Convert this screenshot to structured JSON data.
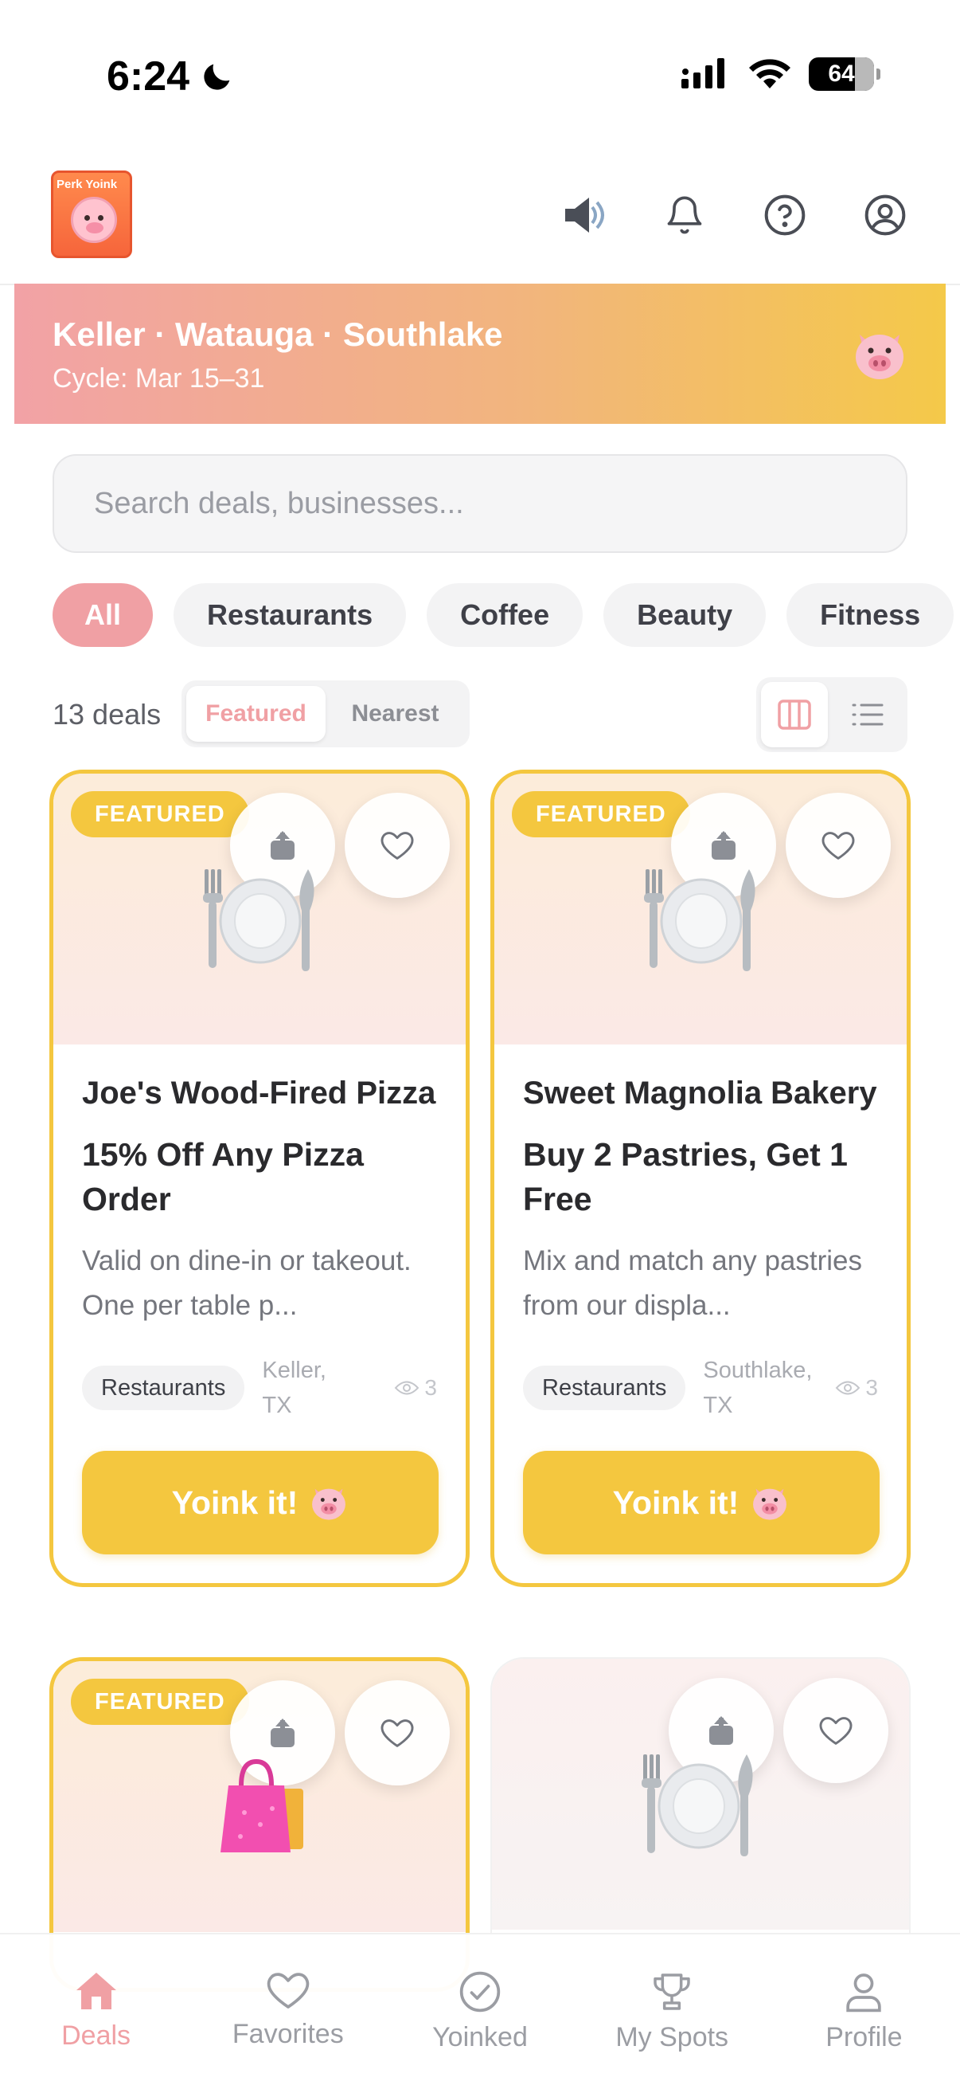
{
  "status_bar": {
    "time": "6:24",
    "battery": "64"
  },
  "header": {
    "logo_text": "Perk Yoink",
    "icons": [
      "speaker-icon",
      "bell-icon",
      "help-icon",
      "account-icon"
    ]
  },
  "banner": {
    "title": "Keller · Watauga · Southlake",
    "cycle": "Cycle: Mar 15–31"
  },
  "search": {
    "placeholder": "Search deals, businesses..."
  },
  "categories": [
    "All",
    "Restaurants",
    "Coffee",
    "Beauty",
    "Fitness"
  ],
  "active_category": "All",
  "toolbar": {
    "deal_count": "13 deals",
    "sort_options": [
      "Featured",
      "Nearest"
    ],
    "active_sort": "Featured",
    "view_modes": [
      "grid-icon",
      "list-icon"
    ],
    "active_view": "grid"
  },
  "deals": [
    {
      "badge": "FEATURED",
      "business": "Joe's Wood-Fired Pizza",
      "title": "15% Off Any Pizza Order",
      "description": "Valid on dine-in or takeout. One per table p...",
      "category": "Restaurants",
      "location": "Keller, TX",
      "views": "3",
      "cta": "Yoink it!",
      "image_icon": "plate-cutlery-icon"
    },
    {
      "badge": "FEATURED",
      "business": "Sweet Magnolia Bakery",
      "title": "Buy 2 Pastries, Get 1 Free",
      "description": "Mix and match any pastries from our displa...",
      "category": "Restaurants",
      "location": "Southlake, TX",
      "views": "3",
      "cta": "Yoink it!",
      "image_icon": "plate-cutlery-icon"
    },
    {
      "badge": "FEATURED",
      "image_icon": "shopping-bags-icon"
    },
    {
      "image_icon": "plate-cutlery-icon"
    }
  ],
  "nav": {
    "items": [
      {
        "label": "Deals",
        "icon": "home-icon"
      },
      {
        "label": "Favorites",
        "icon": "heart-icon"
      },
      {
        "label": "Yoinked",
        "icon": "check-circle-icon"
      },
      {
        "label": "My Spots",
        "icon": "trophy-icon"
      },
      {
        "label": "Profile",
        "icon": "person-icon"
      }
    ],
    "active": "Deals"
  },
  "colors": {
    "accent_pink": "#f0a0a4",
    "accent_yellow": "#f4c73f",
    "banner_gradient": [
      "#f2a2a6",
      "#f2b57d",
      "#f4c949"
    ]
  }
}
